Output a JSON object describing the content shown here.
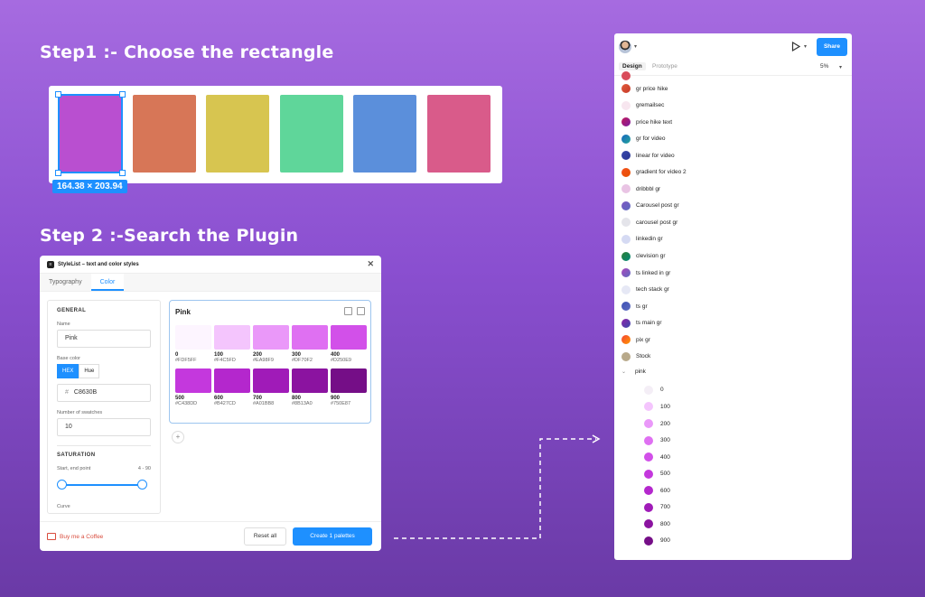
{
  "step1": {
    "title": "Step1 :- Choose the rectangle"
  },
  "step2": {
    "title": "Step 2 :-Search the Plugin"
  },
  "canvas": {
    "dimensions": "164.38 × 203.94",
    "rect_colors": [
      "#b94fd0",
      "#d77657",
      "#d7c550",
      "#5fd69a",
      "#5b8fdb",
      "#d95b8a"
    ]
  },
  "plugin": {
    "title": "StyleList – text and color styles",
    "tabs": [
      "Typography",
      "Color"
    ],
    "active_tab": "Color",
    "general": {
      "section": "GENERAL",
      "name_label": "Name",
      "name_value": "Pink",
      "base_color_label": "Base color",
      "hex_btn": "HEX",
      "hue_btn": "Hue",
      "hex_prefix": "#",
      "hex_value": "C8630B",
      "swatches_label": "Number of swatches",
      "swatches_value": "10"
    },
    "saturation": {
      "section": "SATURATION",
      "range_label": "Start, end point",
      "range_value": "4 - 90",
      "curve_label": "Curve"
    },
    "palette": {
      "name": "Pink",
      "swatches": [
        {
          "step": "0",
          "hex": "#FDF5FF",
          "color": "#fdf5ff"
        },
        {
          "step": "100",
          "hex": "#F4C5FD",
          "color": "#f4c5fd"
        },
        {
          "step": "200",
          "hex": "#EA98F9",
          "color": "#ea98f9"
        },
        {
          "step": "300",
          "hex": "#DF70F2",
          "color": "#df70f2"
        },
        {
          "step": "400",
          "hex": "#D250E9",
          "color": "#d250e9"
        },
        {
          "step": "500",
          "hex": "#C438DD",
          "color": "#c438dd"
        },
        {
          "step": "600",
          "hex": "#B427CD",
          "color": "#b427cd"
        },
        {
          "step": "700",
          "hex": "#A01BB8",
          "color": "#a01bb8"
        },
        {
          "step": "800",
          "hex": "#8B13A0",
          "color": "#8b13a0"
        },
        {
          "step": "900",
          "hex": "#750E87",
          "color": "#750e87"
        }
      ]
    },
    "add_symbol": "+",
    "footer": {
      "coffee": "Buy me a Coffee",
      "reset": "Reset all",
      "create": "Create 1 palettes"
    }
  },
  "figma": {
    "share": "Share",
    "tabs": [
      "Design",
      "Prototype"
    ],
    "zoom": "5%",
    "styles": [
      {
        "label": "gr price hike",
        "color": "linear-gradient(135deg,#e15b3a,#c63a2a)"
      },
      {
        "label": "gremailsec",
        "color": "#f7e6ef"
      },
      {
        "label": "price hike text",
        "color": "linear-gradient(135deg,#c2185b,#7b1fa2)"
      },
      {
        "label": "gr for video",
        "color": "linear-gradient(135deg,#1565c0,#26a69a)"
      },
      {
        "label": "linear for video",
        "color": "linear-gradient(135deg,#3949ab,#283593)"
      },
      {
        "label": "gradient for video 2",
        "color": "linear-gradient(135deg,#f4511e,#e65100)"
      },
      {
        "label": "dribbbl gr",
        "color": "#e9c4e4"
      },
      {
        "label": "Carousel post gr",
        "color": "linear-gradient(135deg,#7e57c2,#5c6bc0)"
      },
      {
        "label": "carousel post gr",
        "color": "#e4e4ea"
      },
      {
        "label": "linkedin gr",
        "color": "#d5daf3"
      },
      {
        "label": "clevision gr",
        "color": "linear-gradient(135deg,#2e7d32,#00897b)"
      },
      {
        "label": "ts linked in gr",
        "color": "linear-gradient(135deg,#ab47bc,#5c6bc0)"
      },
      {
        "label": "tech stack gr",
        "color": "#e6e8f5"
      },
      {
        "label": "ts gr",
        "color": "linear-gradient(135deg,#3f51b5,#5c6bc0)"
      },
      {
        "label": "ts main gr",
        "color": "linear-gradient(135deg,#8e24aa,#3949ab)"
      },
      {
        "label": "pix gr",
        "color": "linear-gradient(135deg,#f44336,#ff9800)"
      },
      {
        "label": "Stock",
        "color": "#b8a98a"
      }
    ],
    "group": {
      "label": "pink",
      "items": [
        {
          "label": "0",
          "color": "#f4eef6"
        },
        {
          "label": "100",
          "color": "#f4c5fd"
        },
        {
          "label": "200",
          "color": "#ea98f9"
        },
        {
          "label": "300",
          "color": "#df70f2"
        },
        {
          "label": "400",
          "color": "#d250e9"
        },
        {
          "label": "500",
          "color": "#c438dd"
        },
        {
          "label": "600",
          "color": "#b427cd"
        },
        {
          "label": "700",
          "color": "#a01bb8"
        },
        {
          "label": "800",
          "color": "#8b13a0"
        },
        {
          "label": "900",
          "color": "#750e87"
        }
      ]
    }
  }
}
